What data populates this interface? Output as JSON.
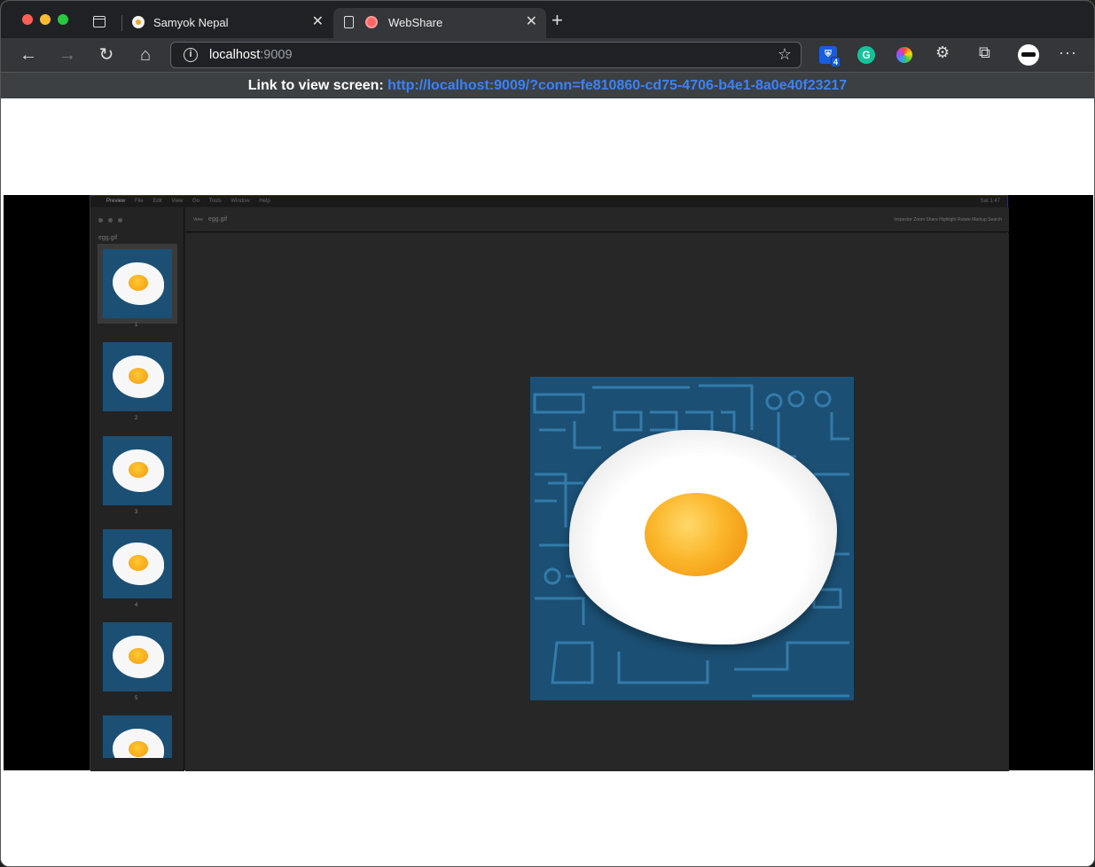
{
  "browser": {
    "tabs": [
      {
        "title": "Samyok Nepal",
        "icon": "egg-favicon"
      },
      {
        "title": "WebShare",
        "icon": "record-favicon",
        "active": true
      }
    ],
    "url_host": "localhost",
    "url_port": ":9009",
    "extensions": [
      {
        "name": "bitwarden-icon",
        "badge": "4"
      },
      {
        "name": "grammarly-icon",
        "letter": "G"
      },
      {
        "name": "color-picker-icon"
      },
      {
        "name": "puzzle-icon"
      },
      {
        "name": "collections-icon"
      }
    ]
  },
  "linkbar": {
    "label": "Link to view screen:",
    "url": "http://localhost:9009/?conn=fe810860-cd75-4706-b4e1-8a0e40f23217"
  },
  "shared_screen": {
    "menu": [
      "Preview",
      "File",
      "Edit",
      "View",
      "Go",
      "Tools",
      "Window",
      "Help"
    ],
    "clock": "Sat 1:47",
    "sidebar_title": "egg.gif",
    "file_name": "egg.gif",
    "toolbar_view": "View",
    "toolbar_tools": "Inspector   Zoom   Share      Highlight   Rotate   Markup   Search",
    "frames": [
      "1",
      "2",
      "3",
      "4",
      "5"
    ]
  }
}
